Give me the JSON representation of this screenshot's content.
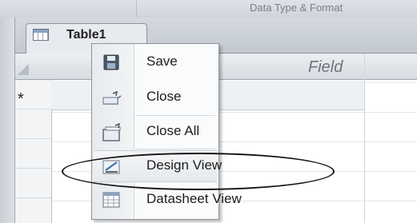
{
  "topbar": {
    "left_text": "",
    "right_text": "Data Type & Format"
  },
  "document_tab": {
    "label": "Table1",
    "icon": "table-icon"
  },
  "datasheet": {
    "column_header": "Field",
    "new_record_marker": "*"
  },
  "context_menu": {
    "items": [
      {
        "label": "Save",
        "icon": "save-icon"
      },
      {
        "label": "Close",
        "icon": "close-document-icon"
      },
      {
        "label": "Close All",
        "icon": "close-all-icon"
      },
      {
        "label": "Design View",
        "icon": "design-view-icon",
        "highlighted": true
      },
      {
        "label": "Datasheet View",
        "icon": "datasheet-view-icon"
      }
    ]
  },
  "colors": {
    "menu_background": "#fafbfc",
    "ribbon": "#cfd4da",
    "callout_outline": "#111111"
  }
}
